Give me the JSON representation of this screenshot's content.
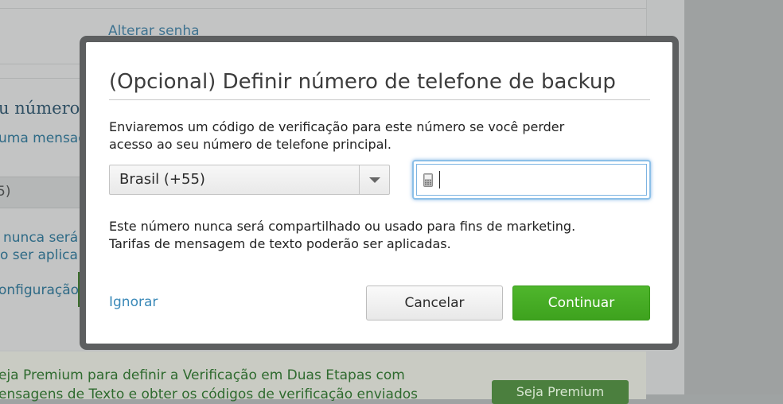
{
  "background": {
    "change_password_link": "Alterar senha",
    "heading_fragment": "u número c",
    "line_fragment_1": "uma mensag",
    "select_fragment": "5)",
    "note_fragment_1": "nunca será c",
    "note_fragment_2": "o ser aplica",
    "settings_fragment": "onfiguração",
    "premium_line_1": "eja Premium para definir a Verificação em Duas Etapas com",
    "premium_line_2": "ensagens de Texto e obter os códigos de verificação enviados",
    "premium_button_label": "Seja Premium"
  },
  "modal": {
    "title": "(Opcional) Definir número de telefone de backup",
    "description_line_1": "Enviaremos um código de verificação para este número se você perder",
    "description_line_2": "acesso ao seu número de telefone principal.",
    "country_select": {
      "selected": "Brasil (+55)"
    },
    "phone_input": {
      "value": "",
      "icon": "mobile-phone-icon"
    },
    "note_line_1": "Este número nunca será compartilhado ou usado para fins de marketing.",
    "note_line_2": "Tarifas de mensagem de texto poderão ser aplicadas.",
    "skip_label": "Ignorar",
    "cancel_label": "Cancelar",
    "continue_label": "Continuar"
  },
  "colors": {
    "accent_green": "#43a824",
    "link_blue": "#3a89b8",
    "focus_blue": "#8cc0e8",
    "overlay": "#bfc1c1"
  }
}
